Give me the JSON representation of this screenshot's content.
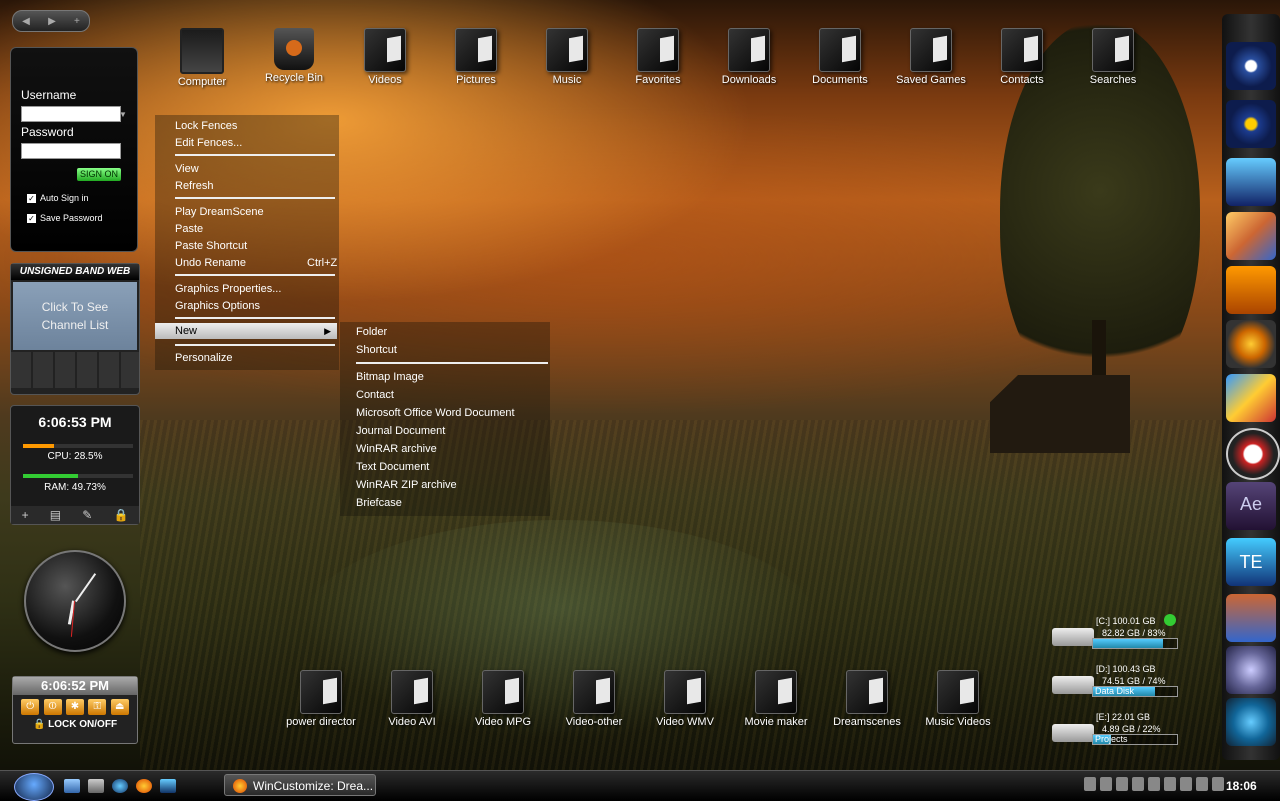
{
  "desktop_icons_top": [
    "Computer",
    "Recycle Bin",
    "Videos",
    "Pictures",
    "Music",
    "Favorites",
    "Downloads",
    "Documents",
    "Saved Games",
    "Contacts",
    "Searches"
  ],
  "desktop_icons_bottom": [
    "power director",
    "Video AVI",
    "Video MPG",
    "Video-other",
    "Video WMV",
    "Movie maker",
    "Dreamscenes",
    "Music Videos"
  ],
  "login_widget": {
    "username_label": "Username",
    "password_label": "Password",
    "signon_label": "SIGN ON",
    "auto_sign_in": "Auto Sign in",
    "save_password": "Save Password"
  },
  "band_widget": {
    "title": "UNSIGNED BAND WEB",
    "screen_line1": "Click To See",
    "screen_line2": "Channel List"
  },
  "system_monitor": {
    "time": "6:06:53 PM",
    "cpu_label": "CPU: 28.5%",
    "cpu_percent": 28.5,
    "ram_label": "RAM: 49.73%",
    "ram_percent": 49.73,
    "tools": [
      "+",
      "▤",
      "✎",
      "🔒"
    ]
  },
  "lock_widget": {
    "time": "6:06:52 PM",
    "footer": "LOCK ON/OFF"
  },
  "context_menu": {
    "items": [
      "Lock Fences",
      "Edit Fences...",
      "View",
      "Refresh",
      "Play DreamScene",
      "Paste",
      "Paste Shortcut",
      "Undo Rename",
      "Graphics Properties...",
      "Graphics Options",
      "New",
      "Personalize"
    ],
    "undo_shortcut": "Ctrl+Z"
  },
  "new_submenu": {
    "items": [
      "Folder",
      "Shortcut",
      "Bitmap Image",
      "Contact",
      "Microsoft Office Word Document",
      "Journal Document",
      "WinRAR archive",
      "Text Document",
      "WinRAR ZIP archive",
      "Briefcase"
    ]
  },
  "drives": [
    {
      "line1": "[C:] 100.01 GB",
      "line2": "82.82 GB / 83%",
      "label": "",
      "used_percent": 83
    },
    {
      "line1": "[D:] 100.43 GB",
      "line2": "74.51 GB / 74%",
      "label": "Data Disk",
      "used_percent": 74
    },
    {
      "line1": "[E:] 22.01 GB",
      "line2": "4.89 GB / 22%",
      "label": "Projects",
      "used_percent": 22
    }
  ],
  "taskbar": {
    "task_button": "WinCustomize: Drea...",
    "clock": "18:06"
  },
  "dock_icon_names": [
    "dvd-icon",
    "media-player-icon",
    "monitor-icon",
    "paint-palette-icon",
    "nero-icon",
    "lightning-icon",
    "paint-icon",
    "director-chair-icon",
    "after-effects-icon",
    "film-icon",
    "film-strip-icon",
    "crystal-icon",
    "settings-icon"
  ]
}
